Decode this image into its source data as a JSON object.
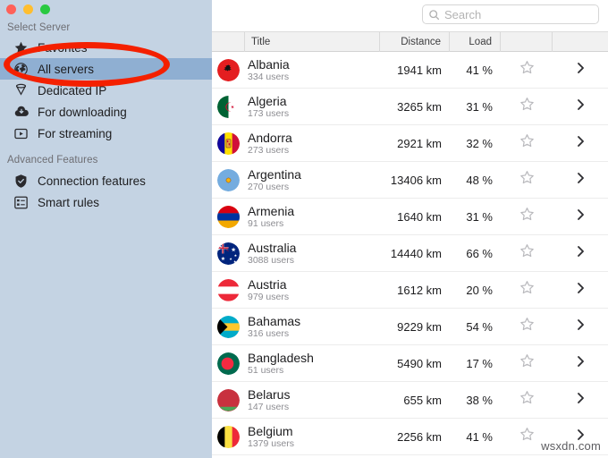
{
  "window": {
    "traffic_lights": [
      {
        "name": "close",
        "color": "#ff6159"
      },
      {
        "name": "minimize",
        "color": "#ffbe2f"
      },
      {
        "name": "maximize",
        "color": "#28c941"
      }
    ]
  },
  "sidebar": {
    "section_select_server": "Select Server",
    "section_advanced": "Advanced Features",
    "primary_items": [
      {
        "label": "Favorites",
        "icon": "star-icon",
        "selected": false
      },
      {
        "label": "All servers",
        "icon": "globe-icon",
        "selected": true
      },
      {
        "label": "Dedicated IP",
        "icon": "location-pin-icon",
        "selected": false
      },
      {
        "label": "For downloading",
        "icon": "cloud-download-icon",
        "selected": false
      },
      {
        "label": "For streaming",
        "icon": "play-screen-icon",
        "selected": false
      }
    ],
    "advanced_items": [
      {
        "label": "Connection features",
        "icon": "shield-check-icon",
        "selected": false
      },
      {
        "label": "Smart rules",
        "icon": "list-grid-icon",
        "selected": false
      }
    ]
  },
  "annotation": {
    "shape": "ellipse",
    "color": "#f42000",
    "target": "All servers"
  },
  "search": {
    "placeholder": "Search",
    "value": "",
    "icon": "search-icon"
  },
  "table": {
    "columns": [
      {
        "key": "flag",
        "label": ""
      },
      {
        "key": "title",
        "label": "Title"
      },
      {
        "key": "distance",
        "label": "Distance"
      },
      {
        "key": "load",
        "label": "Load"
      },
      {
        "key": "favorite",
        "label": ""
      },
      {
        "key": "open",
        "label": ""
      }
    ],
    "rows": [
      {
        "country": "Albania",
        "users": "334 users",
        "distance": "1941 km",
        "load": "41 %",
        "flag": "albania"
      },
      {
        "country": "Algeria",
        "users": "173 users",
        "distance": "3265 km",
        "load": "31 %",
        "flag": "algeria"
      },
      {
        "country": "Andorra",
        "users": "273 users",
        "distance": "2921 km",
        "load": "32 %",
        "flag": "andorra"
      },
      {
        "country": "Argentina",
        "users": "270 users",
        "distance": "13406 km",
        "load": "48 %",
        "flag": "argentina"
      },
      {
        "country": "Armenia",
        "users": "91 users",
        "distance": "1640 km",
        "load": "31 %",
        "flag": "armenia"
      },
      {
        "country": "Australia",
        "users": "3088 users",
        "distance": "14440 km",
        "load": "66 %",
        "flag": "australia"
      },
      {
        "country": "Austria",
        "users": "979 users",
        "distance": "1612 km",
        "load": "20 %",
        "flag": "austria"
      },
      {
        "country": "Bahamas",
        "users": "316 users",
        "distance": "9229 km",
        "load": "54 %",
        "flag": "bahamas"
      },
      {
        "country": "Bangladesh",
        "users": "51 users",
        "distance": "5490 km",
        "load": "17 %",
        "flag": "bangladesh"
      },
      {
        "country": "Belarus",
        "users": "147 users",
        "distance": "655 km",
        "load": "38 %",
        "flag": "belarus"
      },
      {
        "country": "Belgium",
        "users": "1379 users",
        "distance": "2256 km",
        "load": "41 %",
        "flag": "belgium"
      }
    ],
    "row_icons": {
      "favorite": "star-outline-icon",
      "open": "chevron-right-icon"
    }
  },
  "watermark": "wsxdn.com"
}
